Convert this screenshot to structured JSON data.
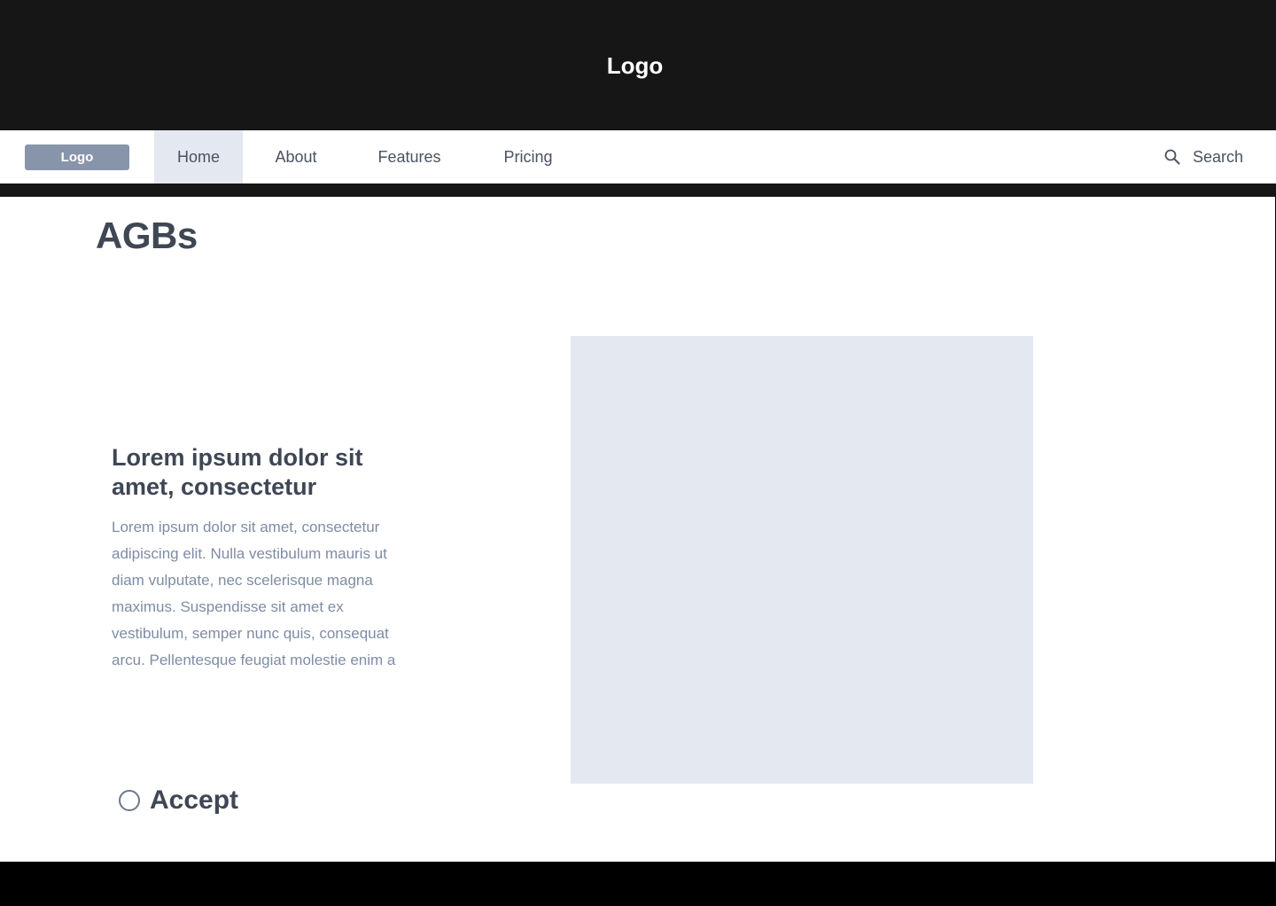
{
  "banner": {
    "logo": "Logo"
  },
  "navbar": {
    "logo": "Logo",
    "items": [
      {
        "label": "Home",
        "active": true
      },
      {
        "label": "About",
        "active": false
      },
      {
        "label": "Features",
        "active": false
      },
      {
        "label": "Pricing",
        "active": false
      }
    ],
    "search": {
      "icon": "search-icon",
      "label": "Search"
    }
  },
  "main": {
    "title": "AGBs",
    "heading": "Lorem ipsum dolor sit amet, consectetur",
    "body": "Lorem ipsum dolor sit amet, consectetur adipiscing elit. Nulla vestibulum mauris ut diam vulputate, nec scelerisque magna maximus. Suspendisse sit amet ex vestibulum, semper nunc quis, consequat arcu. Pellentesque feugiat molestie enim a",
    "accept": {
      "label": "Accept",
      "checked": false
    }
  },
  "colors": {
    "banner_bg": "#161616",
    "nav_logo_bg": "#8794aa",
    "active_tab_bg": "#e4e8f1",
    "heading_text": "#3f4755",
    "body_text": "#7f8ca3",
    "placeholder_bg": "#e4e8f1"
  }
}
